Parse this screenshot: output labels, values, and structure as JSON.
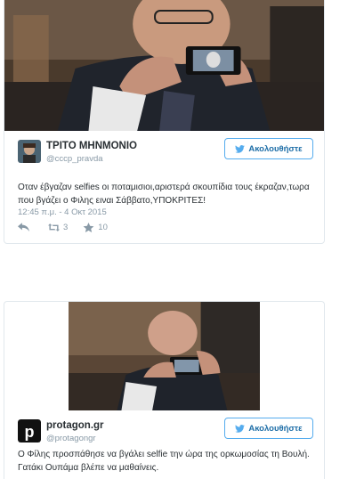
{
  "tweet1": {
    "name": "ΤΡΙΤΟ ΜΗΝΜΟΝΙΟ",
    "handle": "@cccp_pravda",
    "follow_label": "Ακολουθήστε",
    "text": "Οταν έβγαζαν selfies οι ποταμισιοι,αριστερά σκουπίδια τους έκραζαν,τωρα που βγάζει ο Φιλης ειναι Σάββατο,ΥΠΟΚΡΙΤΕΣ!",
    "date": "12:45 π.μ. - 4 Οκτ 2015",
    "retweets": "3",
    "likes": "10",
    "icons": {
      "reply": "reply-icon",
      "retweet": "retweet-icon",
      "like": "star-icon",
      "follow": "twitter-bird-icon"
    }
  },
  "tweet2": {
    "name": "protagon.gr",
    "handle": "@protagongr",
    "follow_label": "Ακολουθήστε",
    "text": "Ο Φίλης προσπάθησε να βγάλει selfie την ώρα της ορκωμοσίας τη Βουλή. Γατάκι Ουπάμα βλέπε να μαθαίνεις.",
    "avatar_letter": "p"
  },
  "colors": {
    "accent": "#55acee",
    "muted": "#8899a6",
    "text": "#292f33",
    "border": "#e1e8ed"
  }
}
